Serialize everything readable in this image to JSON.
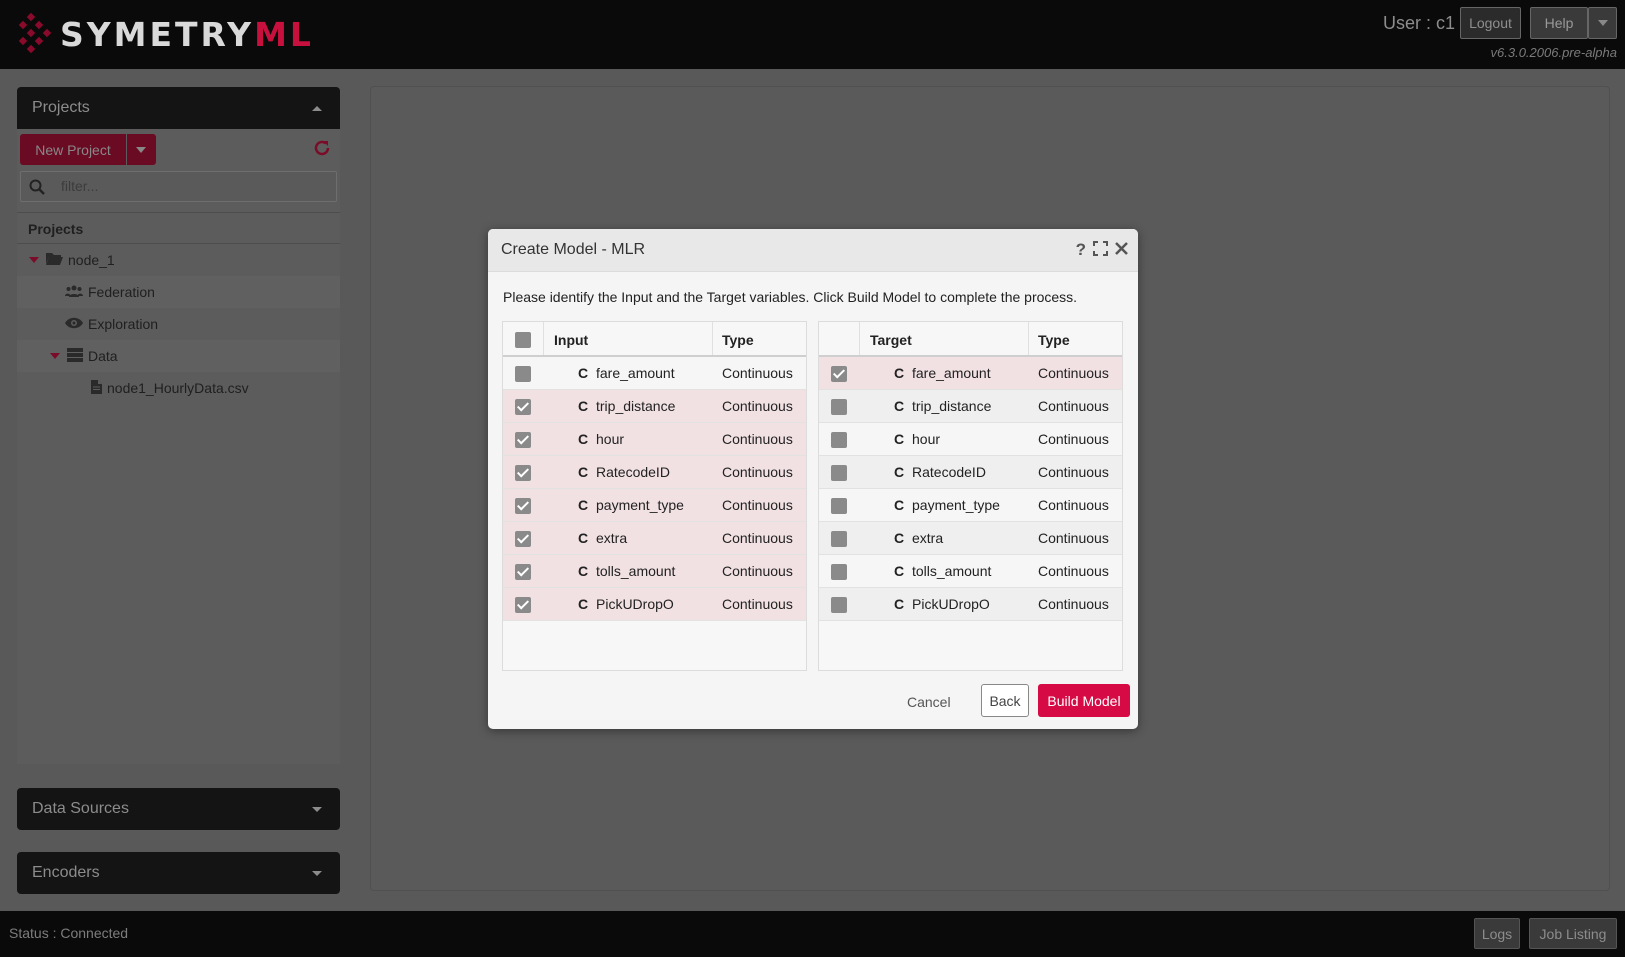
{
  "header": {
    "logo_text_main": "SYMETRY",
    "logo_text_accent": "ML",
    "user_label": "User : c1",
    "logout_label": "Logout",
    "help_label": "Help",
    "version": "v6.3.0.2006.pre-alpha"
  },
  "sidebar": {
    "projects_panel_title": "Projects",
    "new_project_label": "New Project",
    "filter_placeholder": "filter...",
    "tree_header": "Projects",
    "tree": [
      {
        "label": "node_1",
        "icon": "folder-open-icon"
      },
      {
        "label": "Federation",
        "icon": "users-icon"
      },
      {
        "label": "Exploration",
        "icon": "eye-icon"
      },
      {
        "label": "Data",
        "icon": "database-icon"
      },
      {
        "label": "node1_HourlyData.csv",
        "icon": "file-icon"
      }
    ],
    "data_sources_title": "Data Sources",
    "encoders_title": "Encoders"
  },
  "footer": {
    "status": "Status : Connected",
    "logs_label": "Logs",
    "job_listing_label": "Job Listing"
  },
  "modal": {
    "title": "Create Model - MLR",
    "description": "Please identify the Input and the Target variables. Click Build Model to complete the process.",
    "input_table": {
      "header_name": "Input",
      "header_type": "Type",
      "rows": [
        {
          "badge": "C",
          "name": "fare_amount",
          "type": "Continuous",
          "checked": false
        },
        {
          "badge": "C",
          "name": "trip_distance",
          "type": "Continuous",
          "checked": true
        },
        {
          "badge": "C",
          "name": "hour",
          "type": "Continuous",
          "checked": true
        },
        {
          "badge": "C",
          "name": "RatecodeID",
          "type": "Continuous",
          "checked": true
        },
        {
          "badge": "C",
          "name": "payment_type",
          "type": "Continuous",
          "checked": true
        },
        {
          "badge": "C",
          "name": "extra",
          "type": "Continuous",
          "checked": true
        },
        {
          "badge": "C",
          "name": "tolls_amount",
          "type": "Continuous",
          "checked": true
        },
        {
          "badge": "C",
          "name": "PickUDropO",
          "type": "Continuous",
          "checked": true
        }
      ]
    },
    "target_table": {
      "header_name": "Target",
      "header_type": "Type",
      "rows": [
        {
          "badge": "C",
          "name": "fare_amount",
          "type": "Continuous",
          "checked": true
        },
        {
          "badge": "C",
          "name": "trip_distance",
          "type": "Continuous",
          "checked": false
        },
        {
          "badge": "C",
          "name": "hour",
          "type": "Continuous",
          "checked": false
        },
        {
          "badge": "C",
          "name": "RatecodeID",
          "type": "Continuous",
          "checked": false
        },
        {
          "badge": "C",
          "name": "payment_type",
          "type": "Continuous",
          "checked": false
        },
        {
          "badge": "C",
          "name": "extra",
          "type": "Continuous",
          "checked": false
        },
        {
          "badge": "C",
          "name": "tolls_amount",
          "type": "Continuous",
          "checked": false
        },
        {
          "badge": "C",
          "name": "PickUDropO",
          "type": "Continuous",
          "checked": false
        }
      ]
    },
    "cancel_label": "Cancel",
    "back_label": "Back",
    "build_label": "Build Model"
  },
  "colors": {
    "accent": "#d60a45",
    "selected_row": "#f2e1e3",
    "header_bg": "#0a0a0a"
  }
}
